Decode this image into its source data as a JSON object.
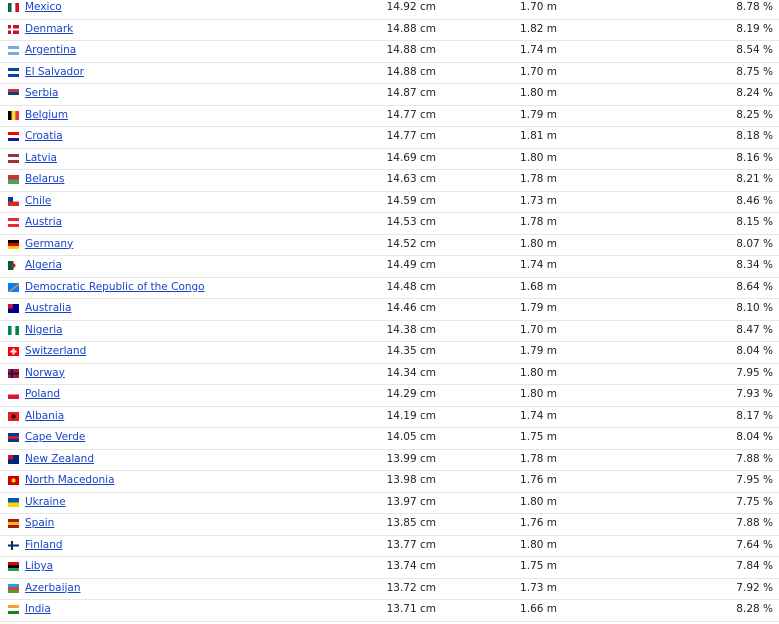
{
  "rows": [
    {
      "country": "Mexico",
      "value1": "14.92 cm",
      "value2": "1.70 m",
      "value3": "8.78 %",
      "flag": {
        "type": "v3",
        "c": [
          "#006847",
          "#ffffff",
          "#ce1126"
        ]
      }
    },
    {
      "country": "Denmark",
      "value1": "14.88 cm",
      "value2": "1.82 m",
      "value3": "8.19 %",
      "flag": {
        "type": "nordic",
        "c": [
          "#c8102e",
          "#ffffff"
        ]
      }
    },
    {
      "country": "Argentina",
      "value1": "14.88 cm",
      "value2": "1.74 m",
      "value3": "8.54 %",
      "flag": {
        "type": "h3",
        "c": [
          "#74acdf",
          "#ffffff",
          "#74acdf"
        ]
      }
    },
    {
      "country": "El Salvador",
      "value1": "14.88 cm",
      "value2": "1.70 m",
      "value3": "8.75 %",
      "flag": {
        "type": "h3",
        "c": [
          "#0047ab",
          "#ffffff",
          "#0047ab"
        ]
      }
    },
    {
      "country": "Serbia",
      "value1": "14.87 cm",
      "value2": "1.80 m",
      "value3": "8.24 %",
      "flag": {
        "type": "h3",
        "c": [
          "#c6363c",
          "#0c4076",
          "#ffffff"
        ]
      }
    },
    {
      "country": "Belgium",
      "value1": "14.77 cm",
      "value2": "1.79 m",
      "value3": "8.25 %",
      "flag": {
        "type": "v3",
        "c": [
          "#000000",
          "#fdda24",
          "#ef3340"
        ]
      }
    },
    {
      "country": "Croatia",
      "value1": "14.77 cm",
      "value2": "1.81 m",
      "value3": "8.18 %",
      "flag": {
        "type": "h3",
        "c": [
          "#ff0000",
          "#ffffff",
          "#171796"
        ]
      }
    },
    {
      "country": "Latvia",
      "value1": "14.69 cm",
      "value2": "1.80 m",
      "value3": "8.16 %",
      "flag": {
        "type": "h3",
        "c": [
          "#9e3039",
          "#ffffff",
          "#9e3039"
        ]
      }
    },
    {
      "country": "Belarus",
      "value1": "14.63 cm",
      "value2": "1.78 m",
      "value3": "8.21 %",
      "flag": {
        "type": "h2",
        "c": [
          "#c8313e",
          "#4aa657"
        ]
      }
    },
    {
      "country": "Chile",
      "value1": "14.59 cm",
      "value2": "1.73 m",
      "value3": "8.46 %",
      "flag": {
        "type": "canton",
        "c": [
          "#ffffff",
          "#d52b1e",
          "#0039a6"
        ]
      }
    },
    {
      "country": "Austria",
      "value1": "14.53 cm",
      "value2": "1.78 m",
      "value3": "8.15 %",
      "flag": {
        "type": "h3",
        "c": [
          "#ed2939",
          "#ffffff",
          "#ed2939"
        ]
      }
    },
    {
      "country": "Germany",
      "value1": "14.52 cm",
      "value2": "1.80 m",
      "value3": "8.07 %",
      "flag": {
        "type": "h3",
        "c": [
          "#000000",
          "#dd0000",
          "#ffce00"
        ]
      }
    },
    {
      "country": "Algeria",
      "value1": "14.49 cm",
      "value2": "1.74 m",
      "value3": "8.34 %",
      "flag": {
        "type": "v2",
        "c": [
          "#006233",
          "#ffffff"
        ]
      }
    },
    {
      "country": "Democratic Republic of the Congo",
      "value1": "14.48 cm",
      "value2": "1.68 m",
      "value3": "8.64 %",
      "flag": {
        "type": "diag",
        "c": [
          "#007fff",
          "#ce1021",
          "#f7d618"
        ]
      }
    },
    {
      "country": "Australia",
      "value1": "14.46 cm",
      "value2": "1.79 m",
      "value3": "8.10 %",
      "flag": {
        "type": "canton",
        "c": [
          "#00008b",
          "#00008b",
          "#cf142b"
        ]
      }
    },
    {
      "country": "Nigeria",
      "value1": "14.38 cm",
      "value2": "1.70 m",
      "value3": "8.47 %",
      "flag": {
        "type": "v3",
        "c": [
          "#008751",
          "#ffffff",
          "#008751"
        ]
      }
    },
    {
      "country": "Switzerland",
      "value1": "14.35 cm",
      "value2": "1.79 m",
      "value3": "8.04 %",
      "flag": {
        "type": "cross",
        "c": [
          "#ff0000",
          "#ffffff"
        ]
      }
    },
    {
      "country": "Norway",
      "value1": "14.34 cm",
      "value2": "1.80 m",
      "value3": "7.95 %",
      "flag": {
        "type": "nordic",
        "c": [
          "#ba0c2f",
          "#00205b"
        ]
      }
    },
    {
      "country": "Poland",
      "value1": "14.29 cm",
      "value2": "1.80 m",
      "value3": "7.93 %",
      "flag": {
        "type": "h2",
        "c": [
          "#ffffff",
          "#dc143c"
        ]
      }
    },
    {
      "country": "Albania",
      "value1": "14.19 cm",
      "value2": "1.74 m",
      "value3": "8.17 %",
      "flag": {
        "type": "emblem",
        "c": [
          "#e41e20",
          "#000000"
        ]
      }
    },
    {
      "country": "Cape Verde",
      "value1": "14.05 cm",
      "value2": "1.75 m",
      "value3": "8.04 %",
      "flag": {
        "type": "h3",
        "c": [
          "#003893",
          "#cf2027",
          "#003893"
        ]
      }
    },
    {
      "country": "New Zealand",
      "value1": "13.99 cm",
      "value2": "1.78 m",
      "value3": "7.88 %",
      "flag": {
        "type": "canton",
        "c": [
          "#00247d",
          "#00247d",
          "#cc142b"
        ]
      }
    },
    {
      "country": "North Macedonia",
      "value1": "13.98 cm",
      "value2": "1.76 m",
      "value3": "7.95 %",
      "flag": {
        "type": "emblem",
        "c": [
          "#d20000",
          "#ffe600"
        ]
      }
    },
    {
      "country": "Ukraine",
      "value1": "13.97 cm",
      "value2": "1.80 m",
      "value3": "7.75 %",
      "flag": {
        "type": "h2",
        "c": [
          "#0057b7",
          "#ffd700"
        ]
      }
    },
    {
      "country": "Spain",
      "value1": "13.85 cm",
      "value2": "1.76 m",
      "value3": "7.88 %",
      "flag": {
        "type": "h3",
        "c": [
          "#aa151b",
          "#f1bf00",
          "#aa151b"
        ]
      }
    },
    {
      "country": "Finland",
      "value1": "13.77 cm",
      "value2": "1.80 m",
      "value3": "7.64 %",
      "flag": {
        "type": "nordic",
        "c": [
          "#ffffff",
          "#002f6c"
        ]
      }
    },
    {
      "country": "Libya",
      "value1": "13.74 cm",
      "value2": "1.75 m",
      "value3": "7.84 %",
      "flag": {
        "type": "h3",
        "c": [
          "#e70013",
          "#000000",
          "#239e46"
        ]
      }
    },
    {
      "country": "Azerbaijan",
      "value1": "13.72 cm",
      "value2": "1.73 m",
      "value3": "7.92 %",
      "flag": {
        "type": "h3",
        "c": [
          "#00b5e2",
          "#ef3340",
          "#509e2f"
        ]
      }
    },
    {
      "country": "India",
      "value1": "13.71 cm",
      "value2": "1.66 m",
      "value3": "8.28 %",
      "flag": {
        "type": "h3",
        "c": [
          "#ff9933",
          "#ffffff",
          "#138808"
        ]
      }
    }
  ]
}
